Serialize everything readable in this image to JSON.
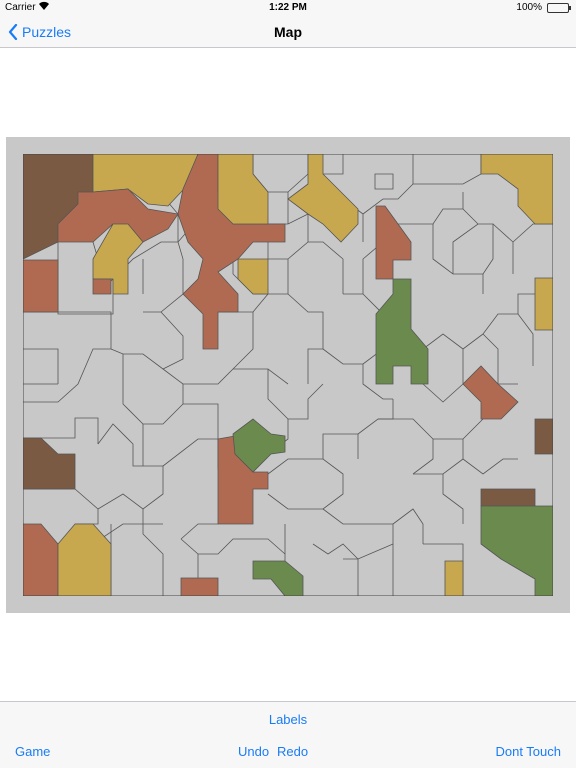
{
  "status": {
    "carrier": "Carrier",
    "time": "1:22 PM",
    "battery": "100%"
  },
  "nav": {
    "back_label": "Puzzles",
    "title": "Map"
  },
  "toolbar": {
    "labels": "Labels",
    "game": "Game",
    "undo": "Undo",
    "redo": "Redo",
    "dont_touch": "Dont Touch"
  },
  "colors": {
    "accent": "#1a7cf5",
    "region_grey": "#c8c8c8",
    "brown_dark": "#7b5a44",
    "brown_red": "#b06a52",
    "tan": "#c8a84e",
    "green": "#6b8b4e"
  }
}
